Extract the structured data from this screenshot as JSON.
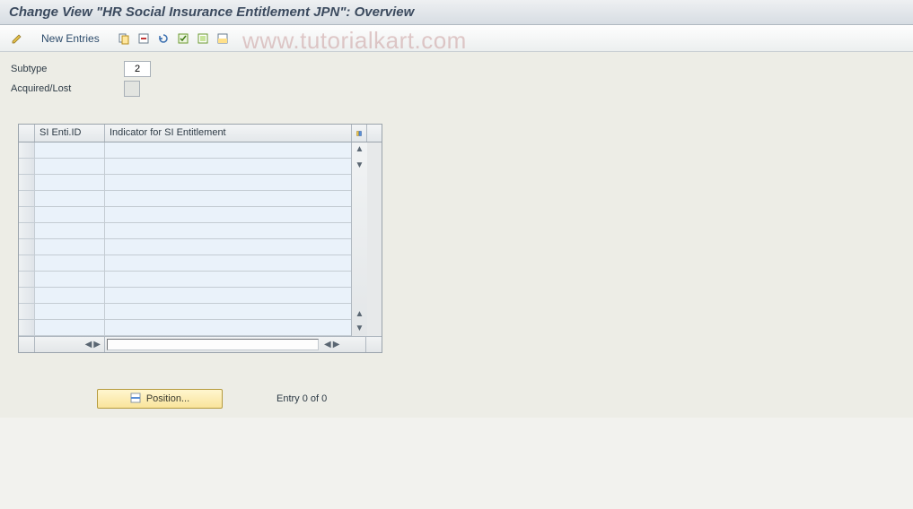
{
  "title": "Change View \"HR Social Insurance Entitlement JPN\": Overview",
  "toolbar": {
    "new_entries_label": "New Entries"
  },
  "form": {
    "subtype_label": "Subtype",
    "subtype_value": "2",
    "acquired_lost_label": "Acquired/Lost",
    "acquired_lost_value": ""
  },
  "table": {
    "headers": {
      "col1": "SI Enti.ID",
      "col2": "Indicator for SI Entitlement"
    },
    "row_count": 12
  },
  "position_btn_label": "Position...",
  "entry_status": "Entry 0 of 0",
  "watermark": "www.tutorialkart.com"
}
